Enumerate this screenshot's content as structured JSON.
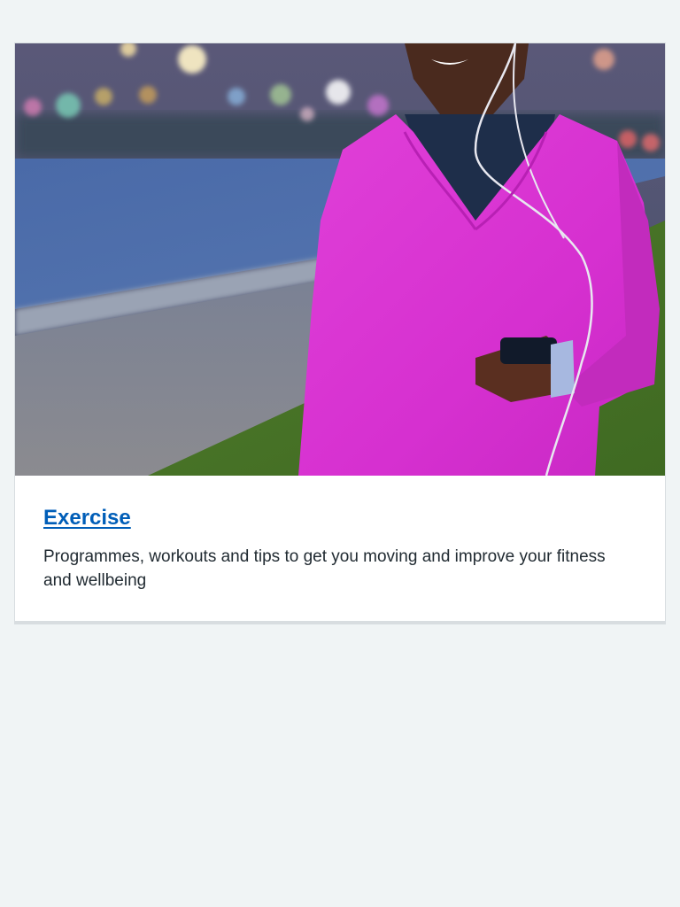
{
  "card": {
    "title": "Exercise",
    "description": "Programmes, workouts and tips to get you moving and improve your fitness and wellbeing",
    "image_subject": "woman-jogging-with-phone-and-earphones",
    "colors": {
      "link": "#005eb8",
      "text": "#212b32",
      "page_background": "#f0f4f5",
      "card_border": "#d8dde0",
      "top_color": "#e032d8"
    }
  }
}
